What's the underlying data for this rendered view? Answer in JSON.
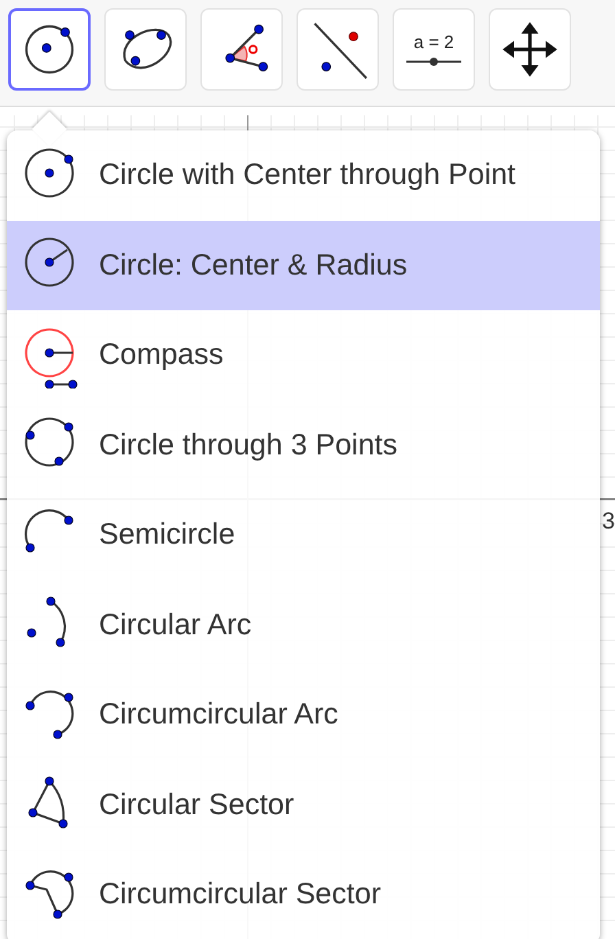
{
  "toolbar": [
    {
      "selected": true
    },
    {
      "selected": false
    },
    {
      "selected": false
    },
    {
      "selected": false
    },
    {
      "selected": false,
      "label": "a = 2"
    },
    {
      "selected": false
    }
  ],
  "graph": {
    "x_tick": "3"
  },
  "menu": {
    "items": [
      {
        "label": "Circle with Center through Point",
        "selected": false
      },
      {
        "label": "Circle: Center & Radius",
        "selected": true
      },
      {
        "label": "Compass",
        "selected": false
      },
      {
        "label": "Circle through 3 Points",
        "selected": false
      },
      {
        "label": "Semicircle",
        "selected": false
      },
      {
        "label": "Circular Arc",
        "selected": false
      },
      {
        "label": "Circumcircular Arc",
        "selected": false
      },
      {
        "label": "Circular Sector",
        "selected": false
      },
      {
        "label": "Circumcircular Sector",
        "selected": false
      }
    ]
  }
}
